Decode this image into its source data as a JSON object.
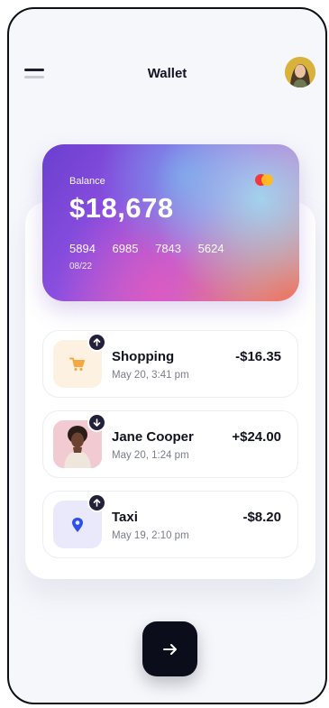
{
  "header": {
    "title": "Wallet",
    "menu_icon": "menu-icon",
    "avatar_icon": "user-avatar"
  },
  "card": {
    "balance_label": "Balance",
    "balance_amount": "$18,678",
    "number_groups": [
      "5894",
      "6985",
      "7843",
      "5624"
    ],
    "expiry": "08/22",
    "brand_icon": "mastercard-icon",
    "gradient_colors": [
      "#6a3fd0",
      "#b560d8",
      "#a0d7f0",
      "#f06e5a"
    ]
  },
  "transactions": [
    {
      "name": "Shopping",
      "date": "May 20, 3:41 pm",
      "amount": "-$16.35",
      "icon": "shopping-cart-icon",
      "direction": "up"
    },
    {
      "name": "Jane Cooper",
      "date": "May 20, 1:24 pm",
      "amount": "+$24.00",
      "icon": "contact-photo",
      "direction": "down"
    },
    {
      "name": "Taxi",
      "date": "May 19, 2:10 pm",
      "amount": "-$8.20",
      "icon": "location-pin-icon",
      "direction": "up"
    }
  ],
  "actions": {
    "next_icon": "arrow-right-icon"
  },
  "colors": {
    "accent": "#0c0d1a",
    "shopping_tile": "#fdf1e2",
    "taxi_tile": "#e9e9fb",
    "pin_blue": "#2f4fe8",
    "cart_orange": "#f5a940"
  }
}
